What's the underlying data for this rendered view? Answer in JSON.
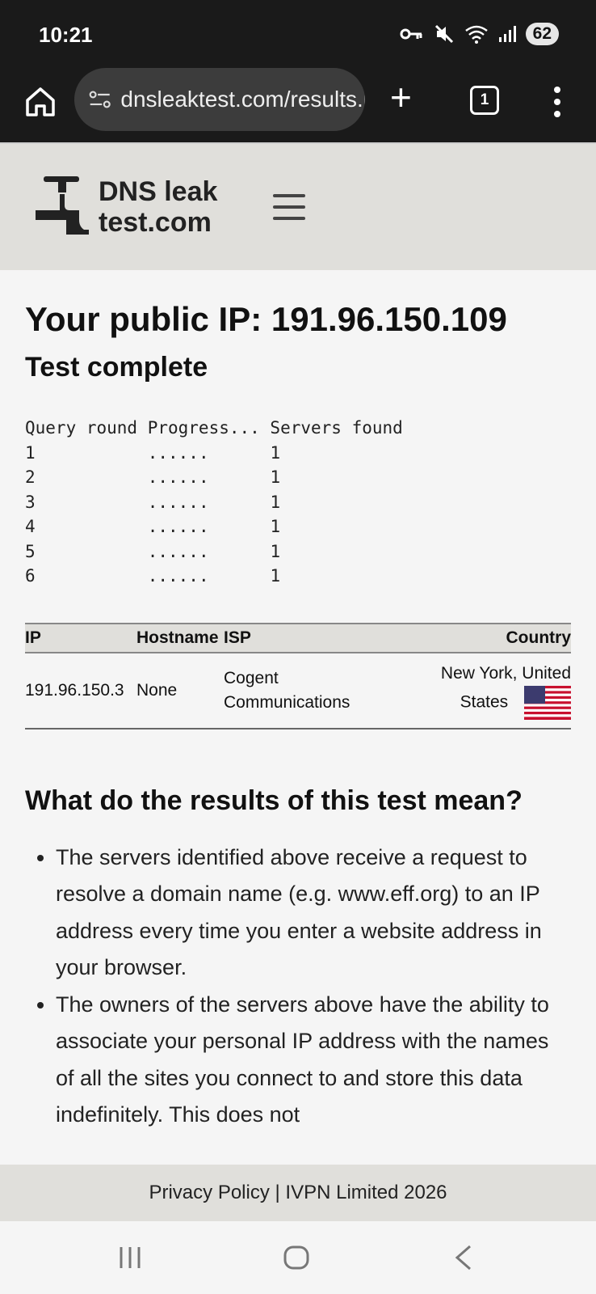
{
  "status_bar": {
    "time": "10:21",
    "battery": "62",
    "icons": [
      "vpn-key-icon",
      "mute-icon",
      "wifi-icon",
      "signal-icon"
    ]
  },
  "browser": {
    "url": "dnsleaktest.com/results.html",
    "tab_count": "1",
    "new_tab_label": "+"
  },
  "site": {
    "logo_line1": "DNS leak",
    "logo_line2": "test.com"
  },
  "main": {
    "title": "Your public IP: 191.96.150.109",
    "status": "Test complete",
    "query_header": "Query round Progress... Servers found",
    "query_rounds": [
      {
        "round": "1",
        "progress": "......",
        "servers": "1"
      },
      {
        "round": "2",
        "progress": "......",
        "servers": "1"
      },
      {
        "round": "3",
        "progress": "......",
        "servers": "1"
      },
      {
        "round": "4",
        "progress": "......",
        "servers": "1"
      },
      {
        "round": "5",
        "progress": "......",
        "servers": "1"
      },
      {
        "round": "6",
        "progress": "......",
        "servers": "1"
      }
    ],
    "table": {
      "headers": {
        "ip": "IP",
        "hostname": "Hostname",
        "isp": "ISP",
        "country": "Country"
      },
      "rows": [
        {
          "ip": "191.96.150.3",
          "hostname": "None",
          "isp_line1": "Cogent",
          "isp_line2": "Communications",
          "country_line1": "New York, United",
          "country_line2": "States",
          "flag": "us-flag-icon"
        }
      ]
    },
    "explain_title": "What do the results of this test mean?",
    "explain_items": [
      "The servers identified above receive a request to resolve a domain name (e.g. www.eff.org) to an IP address every time you enter a website address in your browser.",
      "The owners of the servers above have the ability to associate your personal IP address with the names of all the sites you connect to and store this data indefinitely. This does not"
    ]
  },
  "footer": {
    "text": "Privacy Policy | IVPN Limited 2026"
  },
  "colors": {
    "status_bg": "#1a1a1a",
    "url_pill": "#3c3c3c",
    "header_bg": "#e0dfdb",
    "page_bg": "#f5f5f5"
  }
}
